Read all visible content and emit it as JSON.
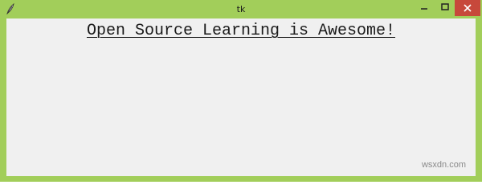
{
  "window": {
    "title": "tk",
    "frame_color": "#a2ce5a",
    "close_color": "#c7483b",
    "icon": "tk-feather-icon"
  },
  "controls": {
    "minimize_icon": "minimize-icon",
    "maximize_icon": "maximize-icon",
    "close_icon": "close-icon"
  },
  "content": {
    "background": "#f0f0f0",
    "headline": "Open Source Learning is Awesome!"
  },
  "watermark": {
    "text": "wsxdn.com"
  }
}
